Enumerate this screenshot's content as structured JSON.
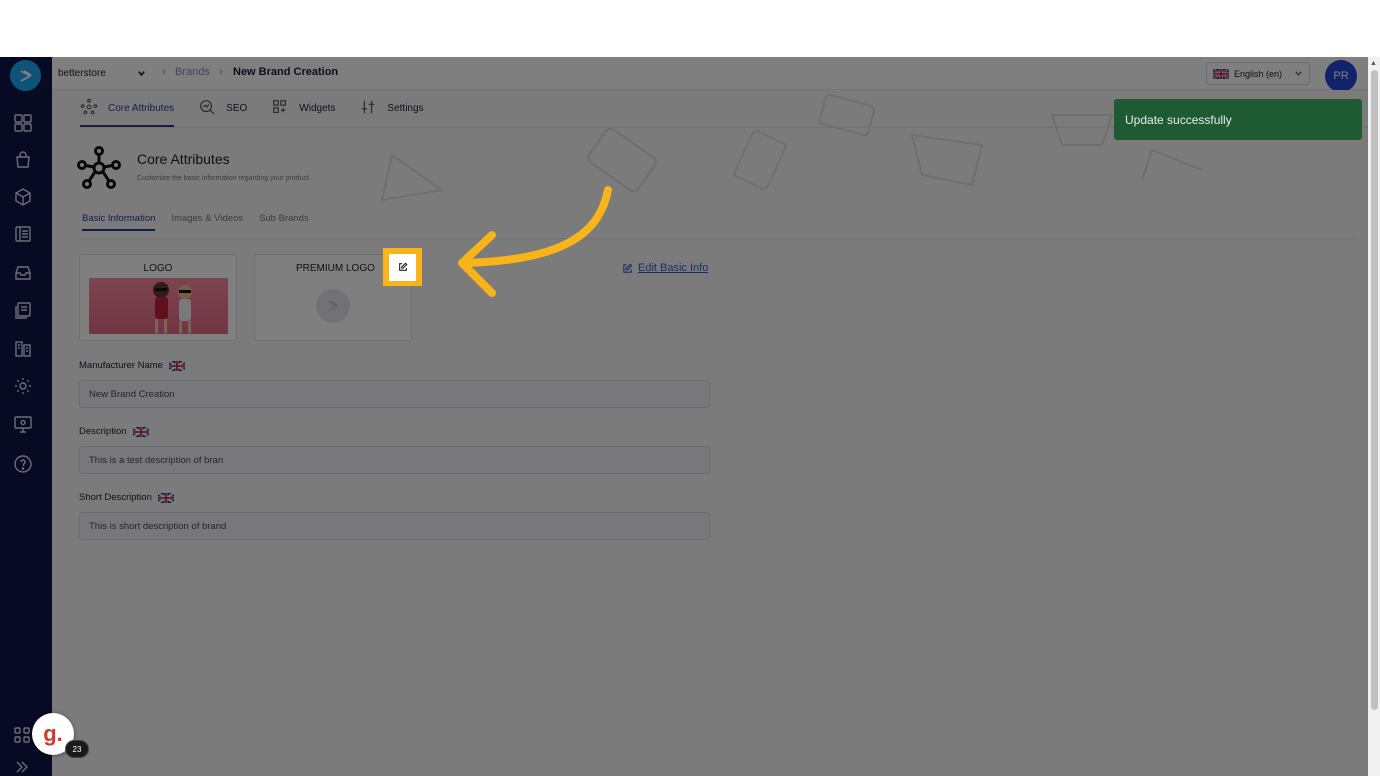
{
  "topbar": {
    "store": "betterstore",
    "breadcrumbs": [
      "Brands",
      "New Brand Creation"
    ],
    "language": "English (en)",
    "avatar_initials": "PR"
  },
  "tabs": [
    {
      "label": "Core Attributes",
      "icon": "network-icon",
      "active": true
    },
    {
      "label": "SEO",
      "icon": "seo-search-icon",
      "active": false
    },
    {
      "label": "Widgets",
      "icon": "widgets-icon",
      "active": false
    },
    {
      "label": "Settings",
      "icon": "sliders-icon",
      "active": false
    }
  ],
  "section": {
    "title": "Core Attributes",
    "subtitle": "Customize the basic information regarding your product."
  },
  "subtabs": [
    {
      "label": "Basic Information",
      "active": true
    },
    {
      "label": "Images & Videos",
      "active": false
    },
    {
      "label": "Sub Brands",
      "active": false
    }
  ],
  "logos": {
    "logo_label": "LOGO",
    "premium_label": "PREMIUM LOGO"
  },
  "edit_basic_info": "Edit Basic Info",
  "fields": {
    "manufacturer_label": "Manufacturer Name",
    "manufacturer_value": "New Brand Creation",
    "description_label": "Description",
    "description_value": "This is a test description of bran",
    "short_description_label": "Short Description",
    "short_description_value": "This is short description of brand"
  },
  "toast": "Update successfully",
  "guide_badge": {
    "letter": "g.",
    "count": "23"
  },
  "colors": {
    "sidebar": "#0e1547",
    "accent": "#243a97",
    "highlight": "#f9b41a",
    "toast": "#1e5b33",
    "link": "#2c5bd8"
  }
}
